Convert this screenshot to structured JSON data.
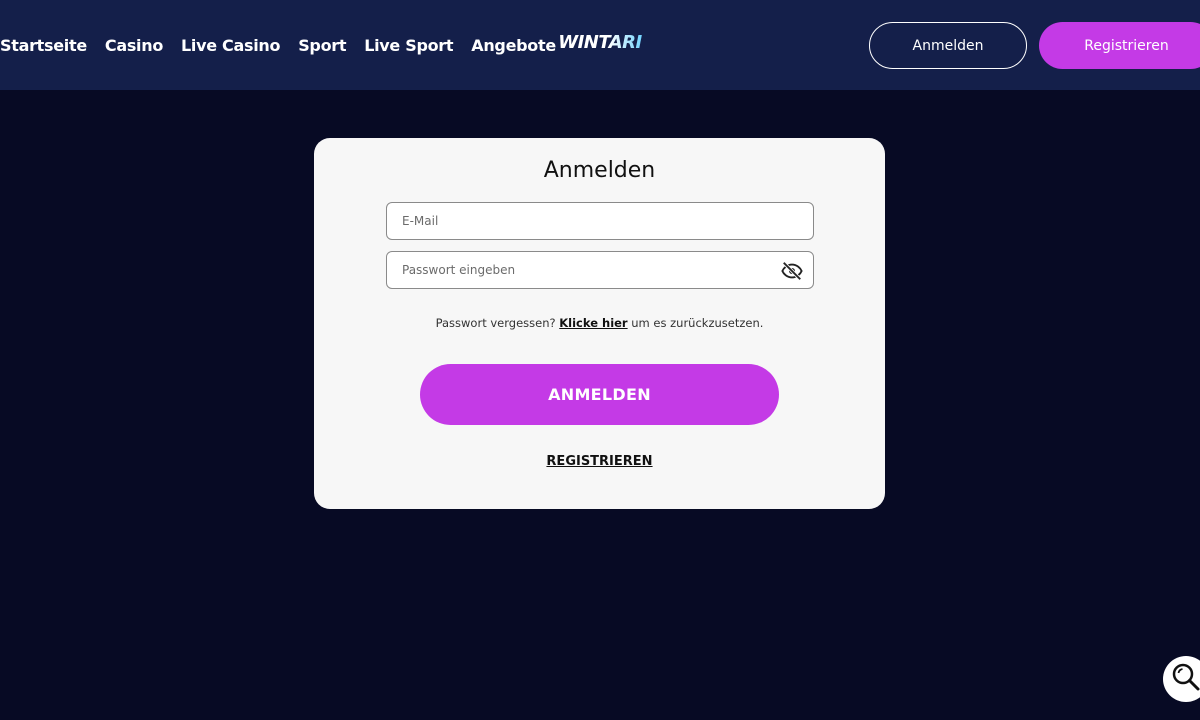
{
  "header": {
    "nav": [
      "Startseite",
      "Casino",
      "Live Casino",
      "Sport",
      "Live Sport",
      "Angebote"
    ],
    "logo_text": "WINTARI",
    "login_label": "Anmelden",
    "register_label": "Registrieren"
  },
  "login_card": {
    "title": "Anmelden",
    "email_placeholder": "E-Mail",
    "password_placeholder": "Passwort eingeben",
    "password_toggle_icon": "eye-slash-icon",
    "forgot_prefix": "Passwort vergessen?",
    "forgot_link": "Klicke hier",
    "forgot_suffix": "um es zurückzusetzen.",
    "submit_label": "ANMELDEN",
    "register_link": "REGISTRIEREN"
  },
  "floating": {
    "search_icon": "search-icon"
  },
  "colors": {
    "background": "#070a24",
    "header": "#141f4a",
    "accent": "#c43ae6",
    "card": "#f7f7f7"
  }
}
